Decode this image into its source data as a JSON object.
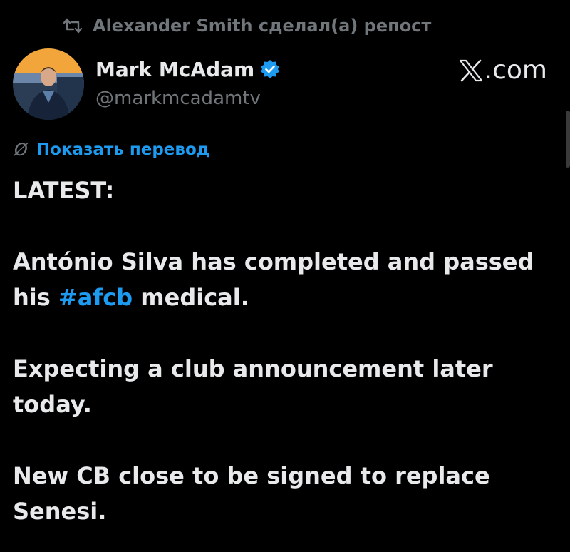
{
  "repost": {
    "icon": "repost-icon",
    "text": "Alexander Smith сделал(а) репост"
  },
  "author": {
    "name": "Mark McAdam",
    "handle": "@markmcadamtv",
    "verified": true,
    "avatar": "avatar"
  },
  "brand": {
    "logo": "x-logo-icon",
    "suffix": ".com"
  },
  "translate": {
    "icon": "globe-icon",
    "label": "Показать перевод"
  },
  "tweet": {
    "line1": "LATEST:",
    "line2": "António Silva has completed and passed",
    "line3_prefix": "his ",
    "hashtag": "#afcb",
    "line3_suffix": " medical.",
    "line4": "Expecting a club announcement later",
    "line5": "today.",
    "line6": "New CB close to be signed to replace",
    "line7": "Senesi."
  },
  "colors": {
    "background": "#000000",
    "text": "#e7e9ea",
    "secondary": "#71767b",
    "accent": "#1d9bf0"
  }
}
